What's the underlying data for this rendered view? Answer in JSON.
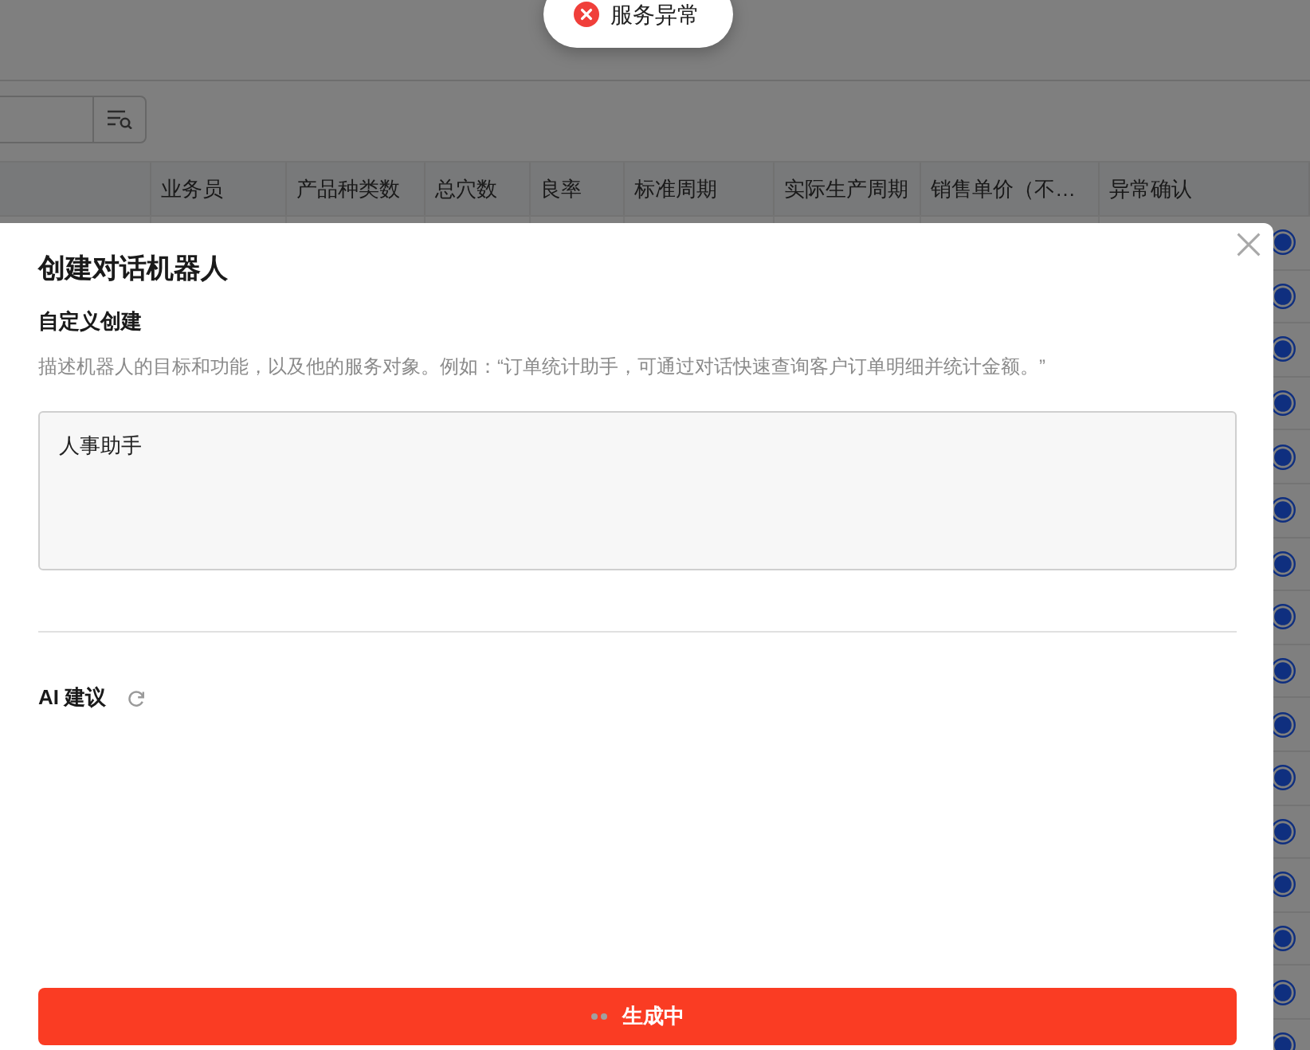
{
  "toast": {
    "kind": "error",
    "message": "服务异常"
  },
  "table": {
    "columns": [
      "业务员",
      "产品种类数",
      "总穴数",
      "良率",
      "标准周期",
      "实际生产周期",
      "销售单价（不…",
      "异常确认"
    ],
    "rows": [
      {
        "confirmed": true
      },
      {
        "confirmed": true
      },
      {
        "confirmed": true
      },
      {
        "confirmed": true
      },
      {
        "confirmed": true
      },
      {
        "confirmed": true
      },
      {
        "confirmed": true
      },
      {
        "confirmed": true
      },
      {
        "confirmed": true
      },
      {
        "confirmed": true
      },
      {
        "confirmed": true
      },
      {
        "confirmed": true
      },
      {
        "confirmed": true
      },
      {
        "confirmed": true
      },
      {
        "confirmed": true
      },
      {
        "confirmed": true
      }
    ]
  },
  "dialog": {
    "title": "创建对话机器人",
    "section_title": "自定义创建",
    "description": "描述机器人的目标和功能，以及他的服务对象。例如：“订单统计助手，可通过对话快速查询客户订单明细并统计金额。”",
    "textarea": {
      "value": "人事助手"
    },
    "ai_suggestions": {
      "title": "AI 建议"
    },
    "submit_button": {
      "label": "生成中",
      "loading": true
    }
  }
}
